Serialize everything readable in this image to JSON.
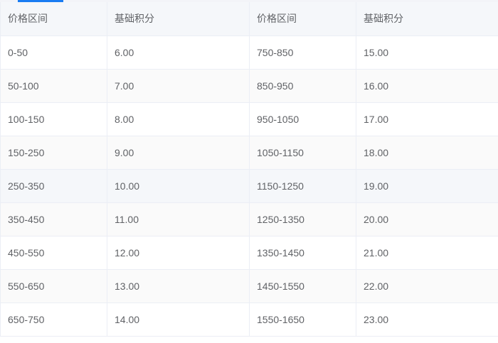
{
  "table": {
    "headers": [
      "价格区间",
      "基础积分",
      "价格区间",
      "基础积分"
    ],
    "rows": [
      [
        "0-50",
        "6.00",
        "750-850",
        "15.00"
      ],
      [
        "50-100",
        "7.00",
        "850-950",
        "16.00"
      ],
      [
        "100-150",
        "8.00",
        "950-1050",
        "17.00"
      ],
      [
        "150-250",
        "9.00",
        "1050-1150",
        "18.00"
      ],
      [
        "250-350",
        "10.00",
        "1150-1250",
        "19.00"
      ],
      [
        "350-450",
        "11.00",
        "1250-1350",
        "20.00"
      ],
      [
        "450-550",
        "12.00",
        "1350-1450",
        "21.00"
      ],
      [
        "550-650",
        "13.00",
        "1450-1550",
        "22.00"
      ],
      [
        "650-750",
        "14.00",
        "1550-1650",
        "23.00"
      ]
    ]
  },
  "colors": {
    "accent": "#1a7cf2",
    "header_bg": "#f5f7fa",
    "text": "#606266",
    "border": "#ebeef5"
  }
}
